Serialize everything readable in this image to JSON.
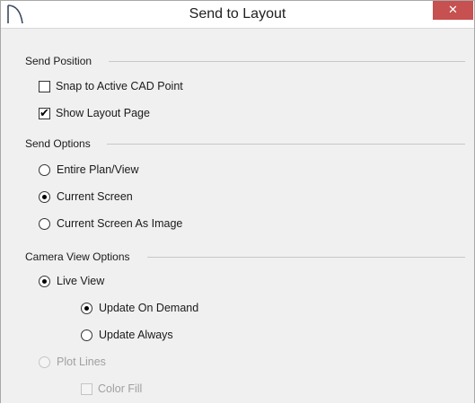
{
  "window": {
    "title": "Send to Layout",
    "close_label": "✕"
  },
  "send_position": {
    "label": "Send Position",
    "snap_to_cad": {
      "label": "Snap to Active CAD Point",
      "checked": false
    },
    "show_layout_page": {
      "label": "Show Layout Page",
      "checked": true
    }
  },
  "send_options": {
    "label": "Send Options",
    "entire_plan": {
      "label": "Entire Plan/View",
      "selected": false
    },
    "current_screen": {
      "label": "Current Screen",
      "selected": true
    },
    "current_screen_image": {
      "label": "Current Screen As Image",
      "selected": false
    }
  },
  "camera_view_options": {
    "label": "Camera View Options",
    "live_view": {
      "label": "Live View",
      "selected": true
    },
    "update_on_demand": {
      "label": "Update On Demand",
      "selected": true
    },
    "update_always": {
      "label": "Update Always",
      "selected": false
    },
    "plot_lines": {
      "label": "Plot Lines",
      "selected": false,
      "disabled": true
    },
    "color_fill": {
      "label": "Color Fill",
      "checked": false,
      "disabled": true
    }
  },
  "colors": {
    "close_button": "#c75050",
    "dialog_background": "#f0f0f0",
    "disabled_text": "#a0a0a0"
  }
}
